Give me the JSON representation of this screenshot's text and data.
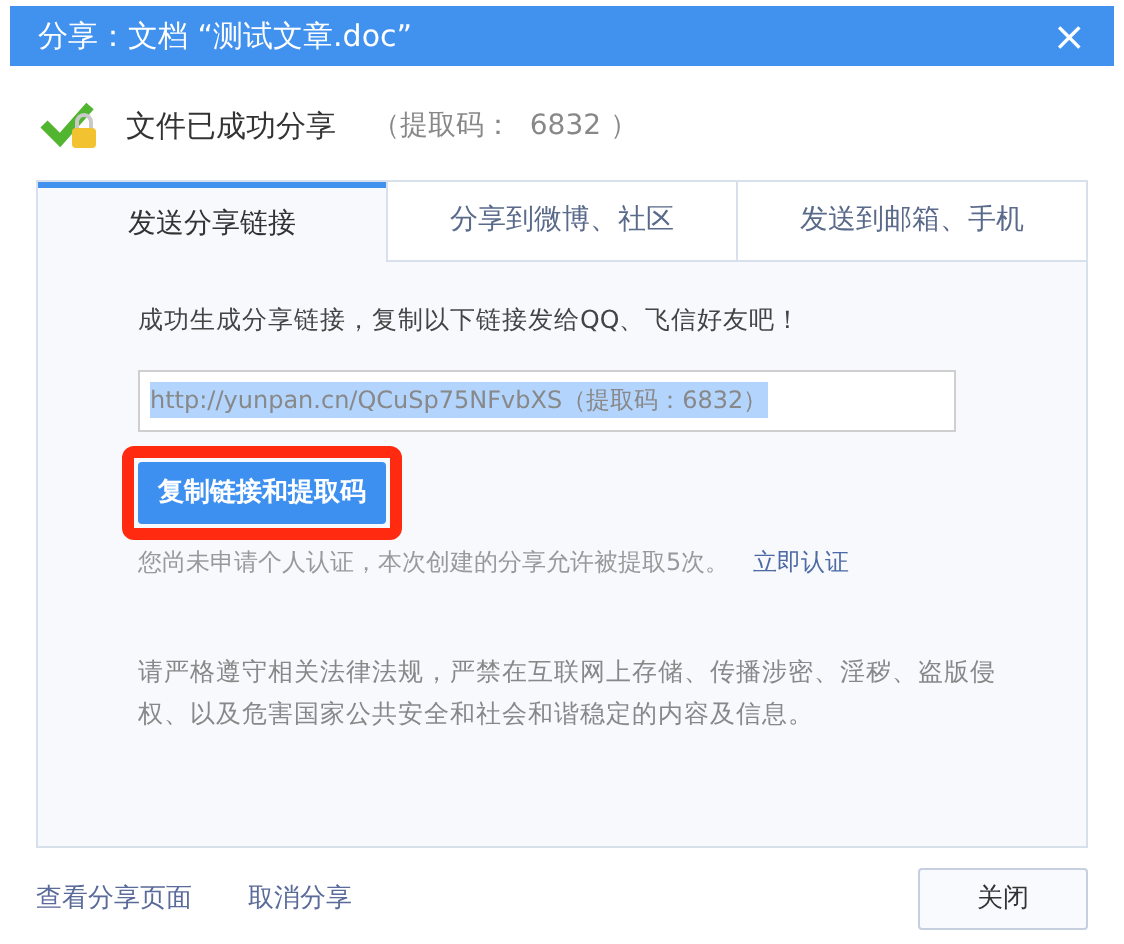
{
  "window": {
    "title": "分享：文档 “测试文章.doc”",
    "close": "×"
  },
  "status": {
    "message": "文件已成功分享",
    "code_text": "（提取码：  6832 ）"
  },
  "tabs": [
    {
      "label": "发送分享链接",
      "selected": true
    },
    {
      "label": "分享到微博、社区",
      "selected": false
    },
    {
      "label": "发送到邮箱、手机",
      "selected": false
    }
  ],
  "panel": {
    "instruction": "成功生成分享链接，复制以下链接发给QQ、飞信好友吧！",
    "link_field": {
      "value": "http://yunpan.cn/QCuSp75NFvbXS（提取码：6832）",
      "text_selected": true
    },
    "copy_button": {
      "label": "复制链接和提取码",
      "highlighted": true
    },
    "notice": "您尚未申请个人认证，本次创建的分享允许被提取5次。",
    "notice_link": "立即认证",
    "legal": "请严格遵守相关法律法规，严禁在互联网上存储、传播涉密、淫秽、盗版侵权、以及危害国家公共安全和社会和谐稳定的内容及信息。"
  },
  "footer": {
    "links": [
      "查看分享页面",
      "取消分享"
    ],
    "close_button": "关闭"
  }
}
